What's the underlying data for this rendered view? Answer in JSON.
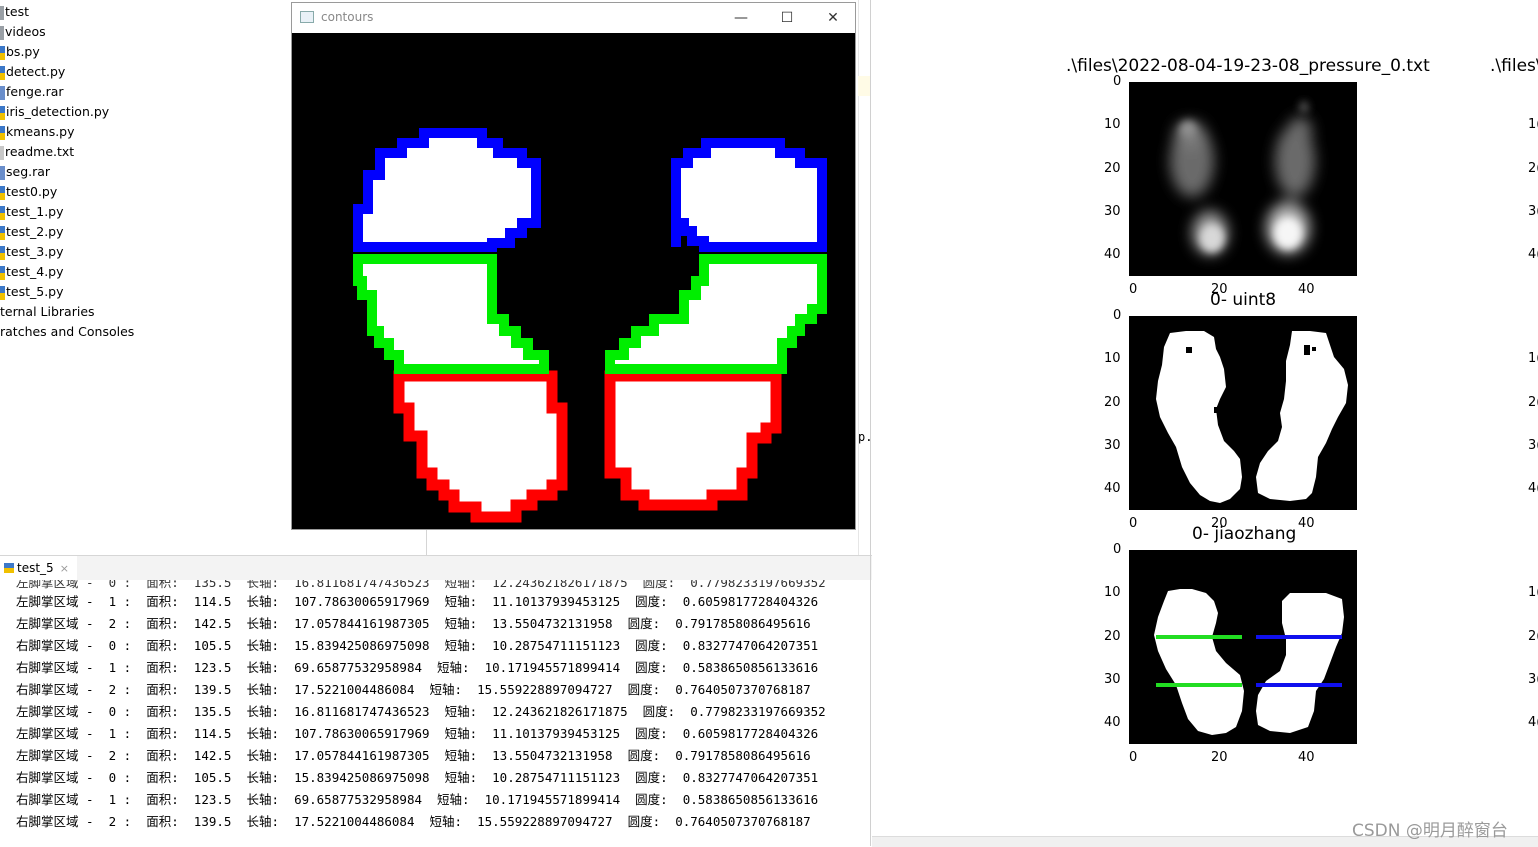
{
  "project_tree": [
    {
      "label": "test",
      "icon": "folder-icon"
    },
    {
      "label": "videos",
      "icon": "folder-icon"
    },
    {
      "label": "bs.py",
      "icon": "python-file-icon"
    },
    {
      "label": "detect.py",
      "icon": "python-file-icon"
    },
    {
      "label": "fenge.rar",
      "icon": "archive-icon"
    },
    {
      "label": "iris_detection.py",
      "icon": "python-file-icon"
    },
    {
      "label": "kmeans.py",
      "icon": "python-file-icon"
    },
    {
      "label": "readme.txt",
      "icon": "text-file-icon"
    },
    {
      "label": "seg.rar",
      "icon": "archive-icon"
    },
    {
      "label": "test0.py",
      "icon": "python-file-icon"
    },
    {
      "label": "test_1.py",
      "icon": "python-file-icon"
    },
    {
      "label": "test_2.py",
      "icon": "python-file-icon"
    },
    {
      "label": "test_3.py",
      "icon": "python-file-icon"
    },
    {
      "label": "test_4.py",
      "icon": "python-file-icon"
    },
    {
      "label": "test_5.py",
      "icon": "python-file-icon"
    },
    {
      "label": "ternal Libraries",
      "icon": ""
    },
    {
      "label": "ratches and Consoles",
      "icon": ""
    }
  ],
  "editor_fragment": "p.",
  "contours_window": {
    "title": "contours",
    "minimize": "—",
    "maximize": "☐",
    "close": "✕"
  },
  "console": {
    "tab_label": "test_5",
    "tab_close": "×",
    "partial_line": "左脚掌区域 -  0 :  面积:  135.5  长轴:  16.811681747436523  短轴:  12.243621826171875  圆度:  0.7798233197669352",
    "lines": [
      "左脚掌区域 -  1 :  面积:  114.5  长轴:  107.78630065917969  短轴:  11.10137939453125  圆度:  0.6059817728404326",
      "左脚掌区域 -  2 :  面积:  142.5  长轴:  17.057844161987305  短轴:  13.5504732131958  圆度:  0.7917858086495616",
      "右脚掌区域 -  0 :  面积:  105.5  长轴:  15.839425086975098  短轴:  10.28754711151123  圆度:  0.8327747064207351",
      "右脚掌区域 -  1 :  面积:  123.5  长轴:  69.65877532958984  短轴:  10.171945571899414  圆度:  0.5838650856133616",
      "右脚掌区域 -  2 :  面积:  139.5  长轴:  17.5221004486084  短轴:  15.559228897094727  圆度:  0.7640507370768187",
      "左脚掌区域 -  0 :  面积:  135.5  长轴:  16.811681747436523  短轴:  12.243621826171875  圆度:  0.7798233197669352",
      "左脚掌区域 -  1 :  面积:  114.5  长轴:  107.78630065917969  短轴:  11.10137939453125  圆度:  0.6059817728404326",
      "左脚掌区域 -  2 :  面积:  142.5  长轴:  17.057844161987305  短轴:  13.5504732131958  圆度:  0.7917858086495616",
      "右脚掌区域 -  0 :  面积:  105.5  长轴:  15.839425086975098  短轴:  10.28754711151123  圆度:  0.8327747064207351",
      "右脚掌区域 -  1 :  面积:  123.5  长轴:  69.65877532958984  短轴:  10.171945571899414  圆度:  0.5838650856133616",
      "右脚掌区域 -  2 :  面积:  139.5  长轴:  17.5221004486084  短轴:  15.559228897094727  圆度:  0.7640507370768187"
    ]
  },
  "plots": {
    "plot1_title": ".\\files\\2022-08-04-19-23-08_pressure_0.txt",
    "plot1_title_right": ".\\files\\",
    "plot2_title": "0- uint8",
    "plot3_title": "0- jiaozhang",
    "y_ticks": [
      "0",
      "10",
      "20",
      "30",
      "40"
    ],
    "x_ticks": [
      "0",
      "20",
      "40"
    ],
    "right_y_ticks": [
      "1(",
      "2(",
      "3(",
      "4("
    ],
    "line_colors": {
      "left_cut": "#22dd22",
      "right_cut": "#1010ee"
    }
  },
  "watermark": "CSDN @明月醉窗台"
}
